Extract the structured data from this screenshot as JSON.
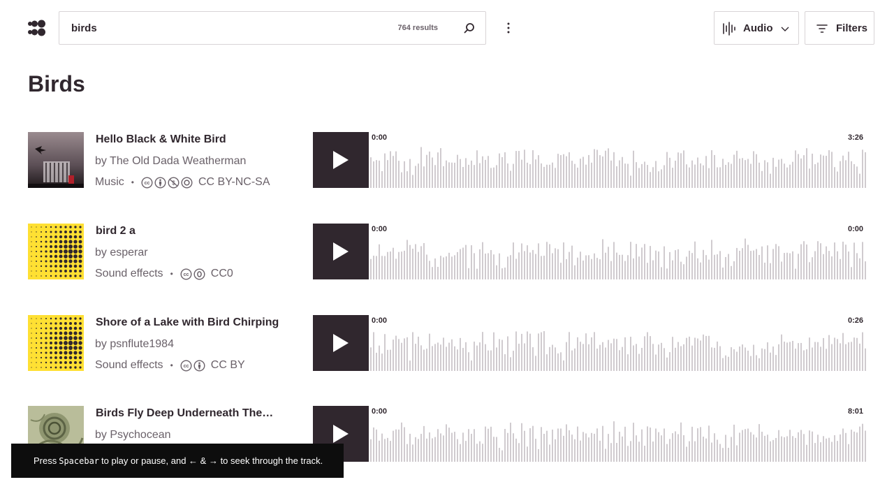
{
  "search": {
    "value": "birds",
    "result_count": "764 results"
  },
  "header": {
    "content_type_label": "Audio",
    "filters_label": "Filters"
  },
  "page_title": "Birds",
  "results": [
    {
      "title": "Hello Black & White Bird",
      "creator": "by The Old Dada Weatherman",
      "category": "Music",
      "license_icons": [
        "cc-icon",
        "by-icon",
        "nc-icon",
        "sa-icon"
      ],
      "license": "CC BY-NC-SA",
      "time_start": "0:00",
      "duration": "3:26",
      "thumb": "photo-dark"
    },
    {
      "title": "bird 2 a",
      "creator": "by esperar",
      "category": "Sound effects",
      "license_icons": [
        "cc-icon",
        "zero-icon"
      ],
      "license": "CC0",
      "time_start": "0:00",
      "duration": "0:00",
      "thumb": "dots-yellow"
    },
    {
      "title": "Shore of a Lake with Bird Chirping",
      "creator": "by psnflute1984",
      "category": "Sound effects",
      "license_icons": [
        "cc-icon",
        "by-icon"
      ],
      "license": "CC BY",
      "time_start": "0:00",
      "duration": "0:26",
      "thumb": "dots-yellow"
    },
    {
      "title": "Birds Fly Deep Underneath The…",
      "creator": "by Psychocean",
      "category": "",
      "license_icons": [],
      "license": "",
      "time_start": "0:00",
      "duration": "8:01",
      "thumb": "photo-green"
    }
  ],
  "snackbar": {
    "before": "Press",
    "key": "Spacebar",
    "after": "to play or pause, and ← & → to seek through the track."
  },
  "colors": {
    "text": "#30272e",
    "muted": "#6a6169",
    "border": "#d8d4d6",
    "waveform": "#d0cbcf",
    "accent_yellow": "#ffe033"
  }
}
